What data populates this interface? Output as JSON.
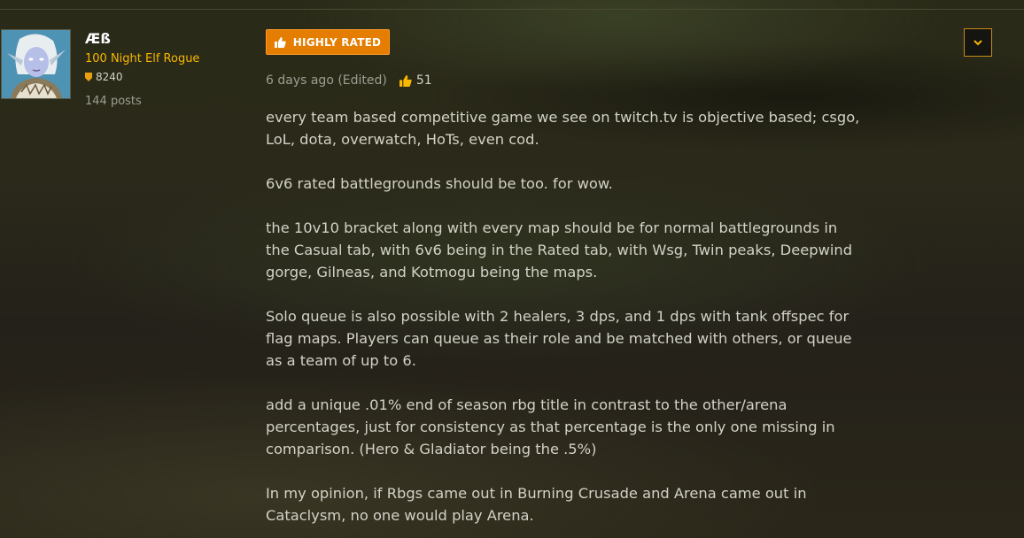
{
  "author": {
    "name": "Æß",
    "character": "100 Night Elf Rogue",
    "achievement_points": "8240",
    "post_count": "144 posts",
    "avatar_icon": "night-elf-avatar"
  },
  "post": {
    "badge_label": "HIGHLY RATED",
    "timestamp": "6 days ago (Edited)",
    "likes": "51",
    "paragraphs": [
      "every team based competitive game we see on twitch.tv is objective based; csgo,\nLoL, dota, overwatch, HoTs, even cod.",
      "6v6 rated battlegrounds should be too. for wow.",
      "the 10v10 bracket along with every map should be for normal battlegrounds in\nthe Casual tab, with 6v6 being in the Rated tab, with Wsg, Twin peaks, Deepwind\ngorge, Gilneas, and Kotmogu being the maps.",
      "Solo queue is also possible with 2 healers, 3 dps, and 1 dps with tank offspec for\nflag maps. Players can queue as their role and be matched with others, or queue\nas a team of up to 6.",
      "add a unique .01% end of season rbg title in contrast to the other/arena\npercentages, just for consistency as that percentage is the only one missing in\ncomparison. (Hero & Gladiator being the .5%)",
      "In my opinion, if Rbgs came out in Burning Crusade and Arena came out in\nCataclysm, no one would play Arena."
    ]
  },
  "colors": {
    "accent": "#e47d00",
    "character_class": "#f8b700",
    "background": "#2a2619",
    "text": "#d2d2c6"
  }
}
